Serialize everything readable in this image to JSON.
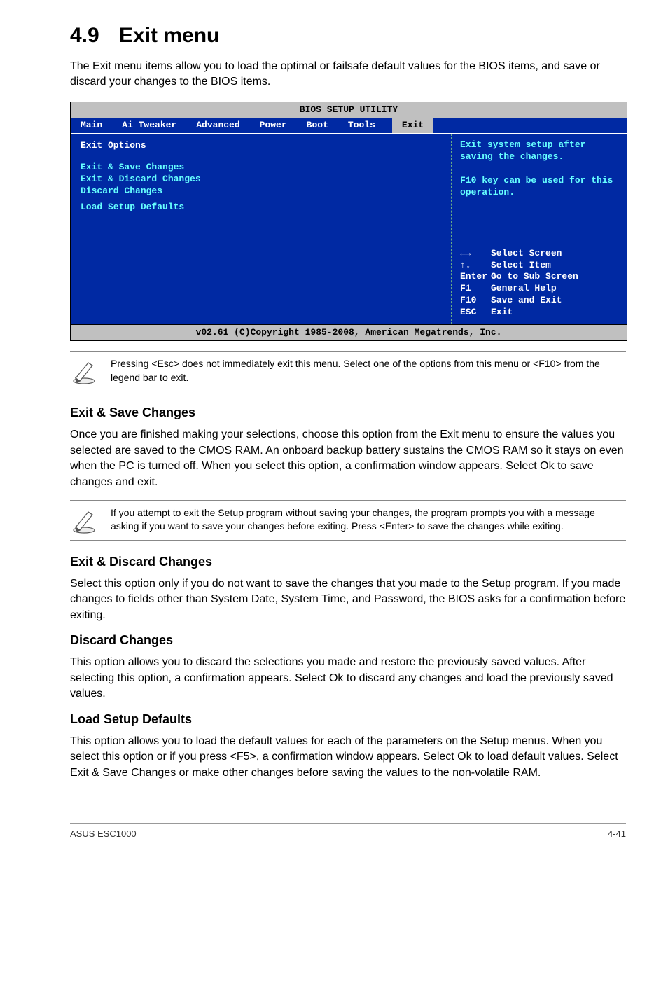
{
  "h1_num": "4.9",
  "h1_title": "Exit menu",
  "intro": "The Exit menu items allow you to load the optimal or failsafe default values for the BIOS items, and save or discard your changes to the BIOS items.",
  "bios": {
    "title": "BIOS SETUP UTILITY",
    "tabs": [
      "Main",
      "Ai Tweaker",
      "Advanced",
      "Power",
      "Boot",
      "Tools",
      "Exit"
    ],
    "left_head": "Exit Options",
    "items": [
      "Exit & Save Changes",
      "Exit & Discard Changes",
      "Discard Changes",
      "Load Setup Defaults"
    ],
    "help": "Exit system setup after saving the changes.\n\nF10 key can be used for this operation.",
    "keys": [
      {
        "k": "←→",
        "d": "Select Screen"
      },
      {
        "k": "↑↓",
        "d": "Select Item"
      },
      {
        "k": "Enter",
        "d": "Go to Sub Screen"
      },
      {
        "k": "F1",
        "d": "General Help"
      },
      {
        "k": "F10",
        "d": "Save and Exit"
      },
      {
        "k": "ESC",
        "d": "Exit"
      }
    ],
    "foot": "v02.61 (C)Copyright 1985-2008, American Megatrends, Inc."
  },
  "note1": "Pressing <Esc> does not immediately exit this menu. Select one of the options from this menu or <F10> from the legend bar to exit.",
  "sec1_h": "Exit & Save Changes",
  "sec1_p": "Once you are finished making your selections, choose this option from the Exit menu to ensure the values you selected are saved to the CMOS RAM. An onboard backup battery sustains the CMOS RAM so it stays on even when the PC is turned off. When you select this option, a confirmation window appears. Select Ok to save changes and exit.",
  "note2": "If you attempt to exit the Setup program without saving your changes, the program prompts you with a message asking if you want to save your changes before exiting. Press <Enter> to save the changes while exiting.",
  "sec2_h": "Exit & Discard Changes",
  "sec2_p": "Select this option only if you do not want to save the changes that you  made to the Setup program. If you made changes to fields other than System Date, System Time, and Password, the BIOS asks for a confirmation before exiting.",
  "sec3_h": "Discard Changes",
  "sec3_p": "This option allows you to discard the selections you made and restore the previously saved values. After selecting this option, a confirmation appears. Select Ok to discard any changes and load the previously saved values.",
  "sec4_h": "Load Setup Defaults",
  "sec4_p": "This option allows you to load the default values for each of the parameters on the Setup menus. When you select this option or if you press <F5>, a confirmation window appears. Select Ok to load default values. Select Exit & Save Changes or make other changes before saving the values to the non-volatile RAM.",
  "foot_left": "ASUS ESC1000",
  "foot_right": "4-41"
}
